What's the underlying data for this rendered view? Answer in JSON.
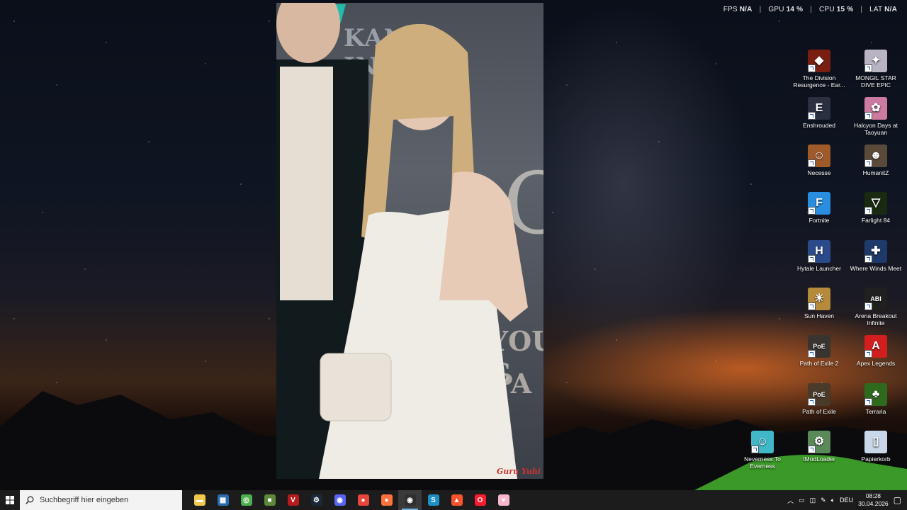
{
  "hud": {
    "fps_label": "FPS",
    "fps_value": "N/A",
    "gpu_label": "GPU",
    "gpu_value": "14 %",
    "cpu_label": "CPU",
    "cpu_value": "15 %",
    "lat_label": "LAT",
    "lat_value": "N/A",
    "separator": "|"
  },
  "video": {
    "backdrop_text": "KANE INDUST",
    "backdrop_o": "O",
    "backdrop_you": "YOU C",
    "backdrop_pa": "PA",
    "watermark": "Guru Yuhi"
  },
  "desktop_icons": [
    {
      "label": "The Division Resurgence - Ear...",
      "icon": "division-icon",
      "color": "#7a1e12",
      "glyph": "◆"
    },
    {
      "label": "MONGIL STAR DIVE EPIC",
      "icon": "mongil-icon",
      "color": "#b9b4c4",
      "glyph": "✦"
    },
    {
      "label": "Enshrouded",
      "icon": "enshrouded-icon",
      "color": "#2a3040",
      "glyph": "E"
    },
    {
      "label": "Halcyon Days at Taoyuan",
      "icon": "halcyon-icon",
      "color": "#cc7aa0",
      "glyph": "✿"
    },
    {
      "label": "Necesse",
      "icon": "necesse-icon",
      "color": "#a05a2a",
      "glyph": "☺"
    },
    {
      "label": "HumanitZ",
      "icon": "humanitz-icon",
      "color": "#5a4a3a",
      "glyph": "☻"
    },
    {
      "label": "Fortnite",
      "icon": "fortnite-icon",
      "color": "#2a8ee0",
      "glyph": "F"
    },
    {
      "label": "Farlight 84",
      "icon": "farlight-icon",
      "color": "#1a2a10",
      "glyph": "▽"
    },
    {
      "label": "Hytale Launcher",
      "icon": "hytale-icon",
      "color": "#2a4a8a",
      "glyph": "H"
    },
    {
      "label": "Where Winds Meet",
      "icon": "where-winds-meet-icon",
      "color": "#1e3a6a",
      "glyph": "✚"
    },
    {
      "label": "Sun Haven",
      "icon": "sun-haven-icon",
      "color": "#b58a3a",
      "glyph": "☀"
    },
    {
      "label": "Arena Breakout Infinite",
      "icon": "abi-icon",
      "color": "#202020",
      "glyph": "ABI"
    },
    {
      "label": "Path of Exile 2",
      "icon": "poe2-icon",
      "color": "#3a3430",
      "glyph": "PoE"
    },
    {
      "label": "Apex Legends",
      "icon": "apex-icon",
      "color": "#d21e1e",
      "glyph": "A"
    },
    {
      "label": "Path of Exile",
      "icon": "poe-icon",
      "color": "#4a3a2a",
      "glyph": "PoE"
    },
    {
      "label": "Terraria",
      "icon": "terraria-icon",
      "color": "#2e6a1e",
      "glyph": "♣"
    },
    {
      "label": "Neverness To Everness",
      "icon": "nte-icon",
      "color": "#40b8c8",
      "glyph": "☺"
    },
    {
      "label": "tModLoader",
      "icon": "tmodloader-icon",
      "color": "#5a8a5a",
      "glyph": "⚙"
    },
    {
      "label": "Papierkorb",
      "icon": "recycle-bin-icon",
      "color": "#c8d8e8",
      "glyph": "▯"
    }
  ],
  "taskbar": {
    "search_placeholder": "Suchbegriff hier eingeben",
    "apps": [
      {
        "name": "file-explorer-icon",
        "color": "#f2c94c",
        "glyph": "▬"
      },
      {
        "name": "store-icon",
        "color": "#2b6cb0",
        "glyph": "▦"
      },
      {
        "name": "xbox-icon",
        "color": "#4caf50",
        "glyph": "◎"
      },
      {
        "name": "minecraft-icon",
        "color": "#5c8a3a",
        "glyph": "■"
      },
      {
        "name": "voicemeeter-icon",
        "color": "#b71c1c",
        "glyph": "V"
      },
      {
        "name": "steam-icon",
        "color": "#1b2838",
        "glyph": "⚙"
      },
      {
        "name": "discord-icon",
        "color": "#5865f2",
        "glyph": "◉"
      },
      {
        "name": "chrome-icon",
        "color": "#e8453c",
        "glyph": "●"
      },
      {
        "name": "firefox-icon",
        "color": "#ff7139",
        "glyph": "●"
      },
      {
        "name": "obs-icon",
        "color": "#302e31",
        "glyph": "◉"
      },
      {
        "name": "app-blue-icon",
        "color": "#1d8fc5",
        "glyph": "S"
      },
      {
        "name": "brave-icon",
        "color": "#fb542b",
        "glyph": "▲"
      },
      {
        "name": "opera-icon",
        "color": "#ff1b2d",
        "glyph": "O"
      },
      {
        "name": "pink-app-icon",
        "color": "#f8b7cd",
        "glyph": "♥"
      }
    ],
    "active_app": "obs-icon",
    "tray_language": "DEU",
    "clock_time": "08:28",
    "clock_date": "30.04.2026"
  }
}
